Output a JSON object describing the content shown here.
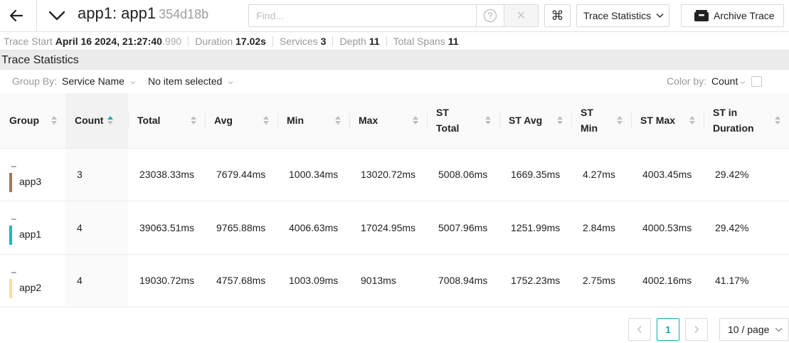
{
  "header": {
    "title": "app1: app1",
    "trace_id": "354d18b",
    "find_placeholder": "Find...",
    "clear_glyph": "✕",
    "kbd_glyph": "⌘",
    "view_label": "Trace Statistics",
    "archive_label": "Archive Trace"
  },
  "summary": {
    "trace_start_label": "Trace Start",
    "trace_start_value": "April 16 2024, 21:27:40",
    "trace_start_ms": ".990",
    "duration_label": "Duration",
    "duration_value": "17.02s",
    "services_label": "Services",
    "services_value": "3",
    "depth_label": "Depth",
    "depth_value": "11",
    "spans_label": "Total Spans",
    "spans_value": "11"
  },
  "section_title": "Trace Statistics",
  "options": {
    "group_by_label": "Group By:",
    "group_by_value": "Service Name",
    "sub_group_value": "No item selected",
    "color_by_label": "Color by:",
    "color_by_value": "Count"
  },
  "table": {
    "columns": [
      "Group",
      "Count",
      "Total",
      "Avg",
      "Min",
      "Max",
      "ST Total",
      "ST Avg",
      "ST Min",
      "ST Max",
      "ST in Duration"
    ],
    "sorted_column": "Count",
    "rows": [
      {
        "group": "app3",
        "color": "#a0775a",
        "toggle": "–",
        "count": "3",
        "total": "23038.33ms",
        "avg": "7679.44ms",
        "min": "1000.34ms",
        "max": "13020.72ms",
        "st_total": "5008.06ms",
        "st_avg": "1669.35ms",
        "st_min": "4.27ms",
        "st_max": "4003.45ms",
        "st_in_duration": "29.42%"
      },
      {
        "group": "app1",
        "color": "#17b8be",
        "toggle": "–",
        "count": "4",
        "total": "39063.51ms",
        "avg": "9765.88ms",
        "min": "4006.63ms",
        "max": "17024.95ms",
        "st_total": "5007.96ms",
        "st_avg": "1251.99ms",
        "st_min": "2.84ms",
        "st_max": "4000.53ms",
        "st_in_duration": "29.42%"
      },
      {
        "group": "app2",
        "color": "#f8dcA0",
        "toggle": "–",
        "count": "4",
        "total": "19030.72ms",
        "avg": "4757.68ms",
        "min": "1003.09ms",
        "max": "9013ms",
        "st_total": "7008.94ms",
        "st_avg": "1752.23ms",
        "st_min": "2.75ms",
        "st_max": "4002.16ms",
        "st_in_duration": "41.17%"
      }
    ]
  },
  "pagination": {
    "current_page": "1",
    "page_size_label": "10 / page"
  },
  "colors": {
    "accent": "#1aa7a7"
  }
}
